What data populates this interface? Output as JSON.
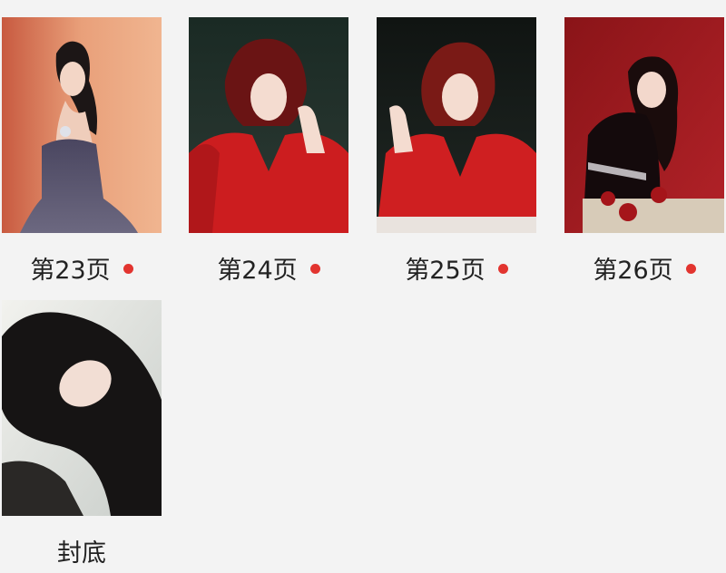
{
  "accent_dot_color": "#e2342f",
  "pages": [
    {
      "label": "第23页",
      "unread": true
    },
    {
      "label": "第24页",
      "unread": true
    },
    {
      "label": "第25页",
      "unread": true
    },
    {
      "label": "第26页",
      "unread": true
    },
    {
      "label": "封底",
      "unread": false
    }
  ]
}
